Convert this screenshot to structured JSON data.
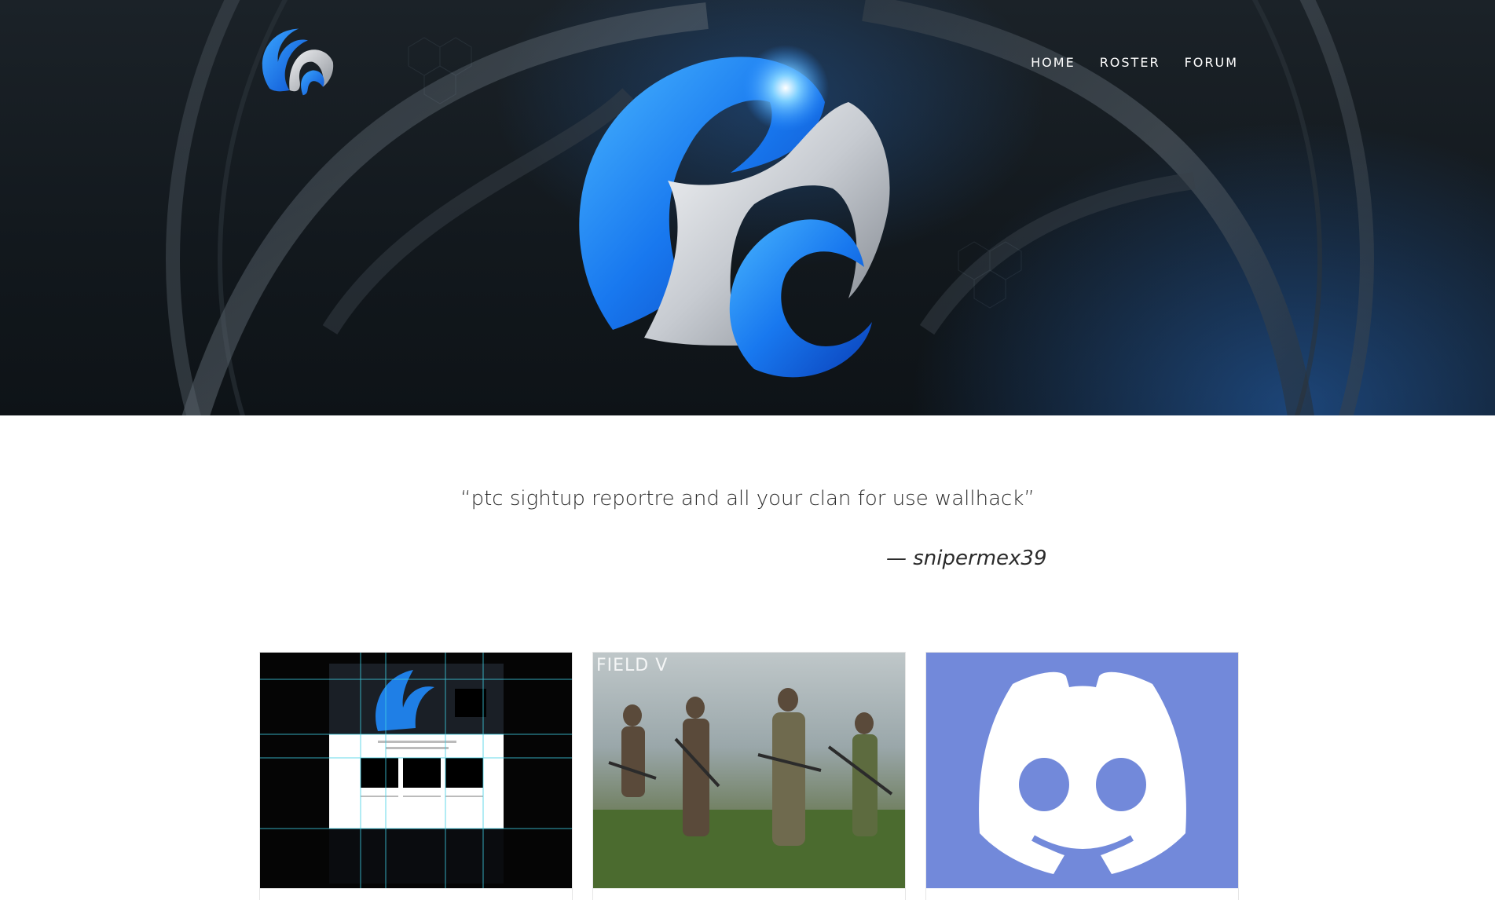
{
  "header": {
    "nav": [
      {
        "label": "HOME"
      },
      {
        "label": "ROSTER"
      },
      {
        "label": "FORUM"
      }
    ]
  },
  "quote": {
    "text": "“ptc sightup reportre and all your clan for use wallhack”",
    "author": "— snipermex39"
  },
  "cards": [
    {
      "image": "website-mockup-screenshot"
    },
    {
      "image": "battlefield-soldiers-screenshot",
      "label": "FIELD V"
    },
    {
      "image": "discord-logo"
    }
  ],
  "colors": {
    "hero_dark": "#12181d",
    "accent_blue": "#1f7fe6",
    "silver": "#c9ccd1",
    "discord": "#7289da"
  }
}
